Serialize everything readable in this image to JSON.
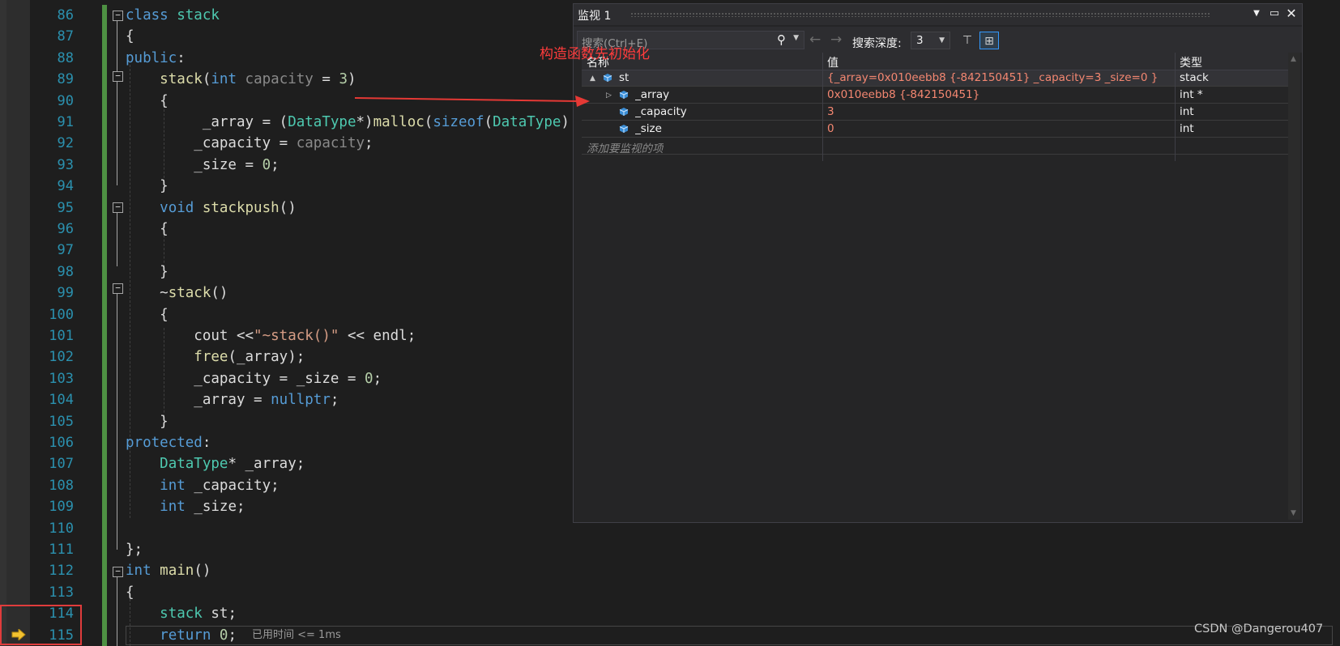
{
  "editor": {
    "line_numbers": [
      "86",
      "87",
      "88",
      "89",
      "90",
      "91",
      "92",
      "93",
      "94",
      "95",
      "96",
      "97",
      "98",
      "99",
      "100",
      "101",
      "102",
      "103",
      "104",
      "105",
      "106",
      "107",
      "108",
      "109",
      "110",
      "111",
      "112",
      "113",
      "114",
      "115"
    ],
    "elapsed_label": "已用时间 <= 1ms",
    "current_line_icon": "arrow-right-icon",
    "lines": [
      [
        [
          "kw",
          "class "
        ],
        [
          "ty",
          "stack"
        ]
      ],
      [
        [
          "plain",
          "{"
        ]
      ],
      [
        [
          "kw",
          "public"
        ],
        [
          "plain",
          ":"
        ]
      ],
      [
        [
          "plain",
          "    "
        ],
        [
          "fn",
          "stack"
        ],
        [
          "plain",
          "("
        ],
        [
          "kw",
          "int "
        ],
        [
          "dim",
          "capacity"
        ],
        [
          "plain",
          " = "
        ],
        [
          "num",
          "3"
        ],
        [
          "plain",
          ")"
        ]
      ],
      [
        [
          "plain",
          "    {"
        ]
      ],
      [
        [
          "plain",
          "         "
        ],
        [
          "plain",
          "_array"
        ],
        [
          "plain",
          " = ("
        ],
        [
          "ty",
          "DataType"
        ],
        [
          "plain",
          "*)"
        ],
        [
          "fn",
          "malloc"
        ],
        [
          "plain",
          "("
        ],
        [
          "kw",
          "sizeof"
        ],
        [
          "plain",
          "("
        ],
        [
          "ty",
          "DataType"
        ],
        [
          "plain",
          ")"
        ]
      ],
      [
        [
          "plain",
          "        _capacity"
        ],
        [
          "plain",
          " = "
        ],
        [
          "dim",
          "capacity"
        ],
        [
          "plain",
          ";"
        ]
      ],
      [
        [
          "plain",
          "        _size"
        ],
        [
          "plain",
          " = "
        ],
        [
          "num",
          "0"
        ],
        [
          "plain",
          ";"
        ]
      ],
      [
        [
          "plain",
          "    }"
        ]
      ],
      [
        [
          "plain",
          "    "
        ],
        [
          "kw",
          "void "
        ],
        [
          "fn",
          "stackpush"
        ],
        [
          "plain",
          "()"
        ]
      ],
      [
        [
          "plain",
          "    {"
        ]
      ],
      [
        [
          "plain",
          ""
        ]
      ],
      [
        [
          "plain",
          "    }"
        ]
      ],
      [
        [
          "plain",
          "    ~"
        ],
        [
          "fn",
          "stack"
        ],
        [
          "plain",
          "()"
        ]
      ],
      [
        [
          "plain",
          "    {"
        ]
      ],
      [
        [
          "plain",
          "        cout "
        ],
        [
          "plain",
          "<<"
        ],
        [
          "str",
          "\"~stack()\""
        ],
        [
          "plain",
          " << endl;"
        ]
      ],
      [
        [
          "plain",
          "        "
        ],
        [
          "fn",
          "free"
        ],
        [
          "plain",
          "(_array);"
        ]
      ],
      [
        [
          "plain",
          "        _capacity = _size = "
        ],
        [
          "num",
          "0"
        ],
        [
          "plain",
          ";"
        ]
      ],
      [
        [
          "plain",
          "        _array = "
        ],
        [
          "kw",
          "nullptr"
        ],
        [
          "plain",
          ";"
        ]
      ],
      [
        [
          "plain",
          "    }"
        ]
      ],
      [
        [
          "kw",
          "protected"
        ],
        [
          "plain",
          ":"
        ]
      ],
      [
        [
          "plain",
          "    "
        ],
        [
          "ty",
          "DataType"
        ],
        [
          "plain",
          "* _array;"
        ]
      ],
      [
        [
          "plain",
          "    "
        ],
        [
          "kw",
          "int "
        ],
        [
          "plain",
          "_capacity;"
        ]
      ],
      [
        [
          "plain",
          "    "
        ],
        [
          "kw",
          "int "
        ],
        [
          "plain",
          "_size;"
        ]
      ],
      [
        [
          "plain",
          ""
        ]
      ],
      [
        [
          "plain",
          "};"
        ]
      ],
      [
        [
          "kw",
          "int "
        ],
        [
          "fn",
          "main"
        ],
        [
          "plain",
          "()"
        ]
      ],
      [
        [
          "plain",
          "{"
        ]
      ],
      [
        [
          "plain",
          "    "
        ],
        [
          "ty",
          "stack "
        ],
        [
          "plain",
          "st;"
        ]
      ],
      [
        [
          "plain",
          "    "
        ],
        [
          "kw",
          "return "
        ],
        [
          "num",
          "0"
        ],
        [
          "plain",
          ";"
        ]
      ]
    ]
  },
  "watch": {
    "title": "监视 1",
    "search_placeholder": "搜索(Ctrl+E)",
    "depth_label": "搜索深度:",
    "depth_value": "3",
    "columns": {
      "name": "名称",
      "value": "值",
      "type": "类型"
    },
    "rows": [
      {
        "name": "st",
        "value": "{_array=0x010eebb8 {-842150451} _capacity=3 _size=0 }",
        "type": "stack",
        "expander": "▲",
        "indent": 0
      },
      {
        "name": "_array",
        "value": "0x010eebb8 {-842150451}",
        "type": "int *",
        "expander": "▷",
        "indent": 1
      },
      {
        "name": "_capacity",
        "value": "3",
        "type": "int",
        "expander": "",
        "indent": 1
      },
      {
        "name": "_size",
        "value": "0",
        "type": "int",
        "expander": "",
        "indent": 1
      }
    ],
    "add_item_placeholder": "添加要监视的项",
    "colors": {
      "value_text": "#f48771",
      "changed": "#f48771"
    }
  },
  "annotation": {
    "text": "构造函数先初始化",
    "color": "#ff3c3c"
  },
  "watermark": "CSDN @Dangerou407"
}
